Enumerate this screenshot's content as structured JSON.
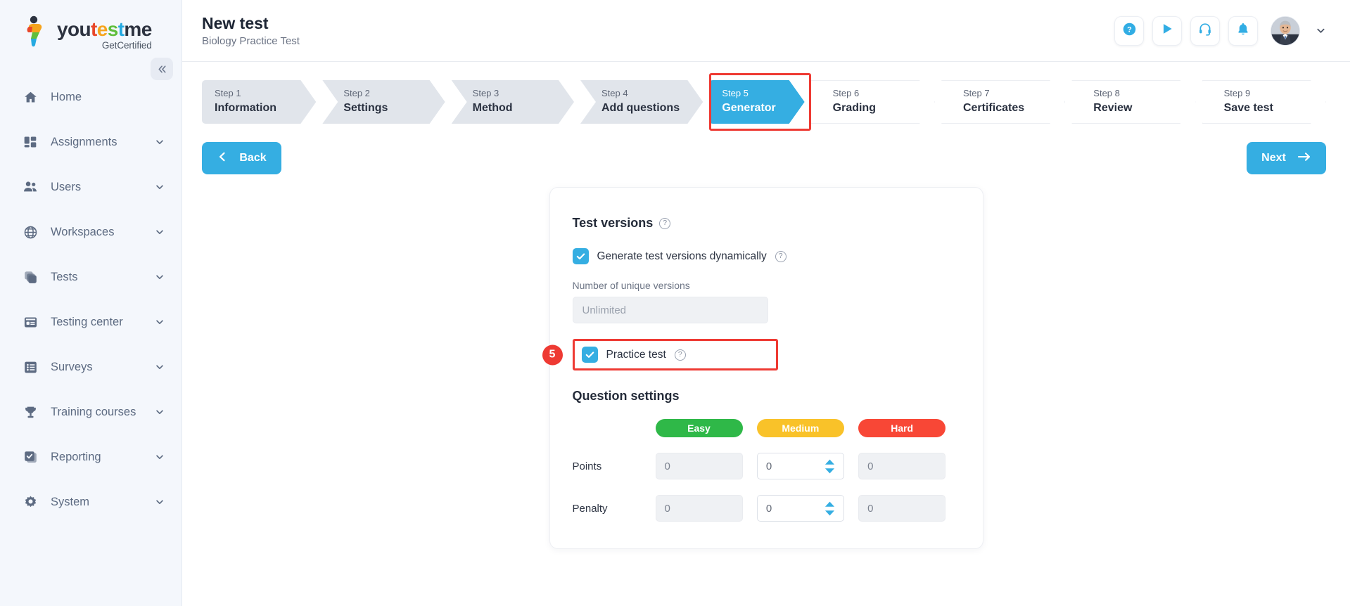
{
  "brand": {
    "name_parts": [
      {
        "text": "you",
        "color": "#2d3340"
      },
      {
        "text": "t",
        "color": "#e8472a"
      },
      {
        "text": "e",
        "color": "#f6a41c"
      },
      {
        "text": "s",
        "color": "#5fbe3b"
      },
      {
        "text": "t",
        "color": "#25aae1"
      },
      {
        "text": "me",
        "color": "#2d3340"
      }
    ],
    "tagline": "GetCertified",
    "collapse_icon": "double-chevron-left-icon"
  },
  "sidebar": {
    "items": [
      {
        "label": "Home",
        "icon": "home-icon",
        "caret": false
      },
      {
        "label": "Assignments",
        "icon": "assignments-icon",
        "caret": true
      },
      {
        "label": "Users",
        "icon": "users-icon",
        "caret": true
      },
      {
        "label": "Workspaces",
        "icon": "globe-icon",
        "caret": true
      },
      {
        "label": "Tests",
        "icon": "tests-stack-icon",
        "caret": true
      },
      {
        "label": "Testing center",
        "icon": "testing-center-icon",
        "caret": true
      },
      {
        "label": "Surveys",
        "icon": "surveys-list-icon",
        "caret": true
      },
      {
        "label": "Training courses",
        "icon": "trophy-icon",
        "caret": true
      },
      {
        "label": "Reporting",
        "icon": "reporting-icon",
        "caret": true
      },
      {
        "label": "System",
        "icon": "gear-icon",
        "caret": true
      }
    ]
  },
  "header": {
    "title": "New test",
    "subtitle": "Biology Practice Test",
    "actions": [
      {
        "name": "help-icon"
      },
      {
        "name": "play-icon"
      },
      {
        "name": "headset-support-icon"
      },
      {
        "name": "bell-notification-icon"
      }
    ],
    "avatar_caret": "chevron-down-icon"
  },
  "wizard": {
    "steps": [
      {
        "num": "Step 1",
        "name": "Information",
        "state": "done"
      },
      {
        "num": "Step 2",
        "name": "Settings",
        "state": "done"
      },
      {
        "num": "Step 3",
        "name": "Method",
        "state": "done"
      },
      {
        "num": "Step 4",
        "name": "Add questions",
        "state": "done"
      },
      {
        "num": "Step 5",
        "name": "Generator",
        "state": "active"
      },
      {
        "num": "Step 6",
        "name": "Grading",
        "state": "upcoming"
      },
      {
        "num": "Step 7",
        "name": "Certificates",
        "state": "upcoming"
      },
      {
        "num": "Step 8",
        "name": "Review",
        "state": "upcoming"
      },
      {
        "num": "Step 9",
        "name": "Save test",
        "state": "upcoming"
      }
    ],
    "active_highlight_color": "#ee3a33",
    "active_color": "#35aee2"
  },
  "nav_buttons": {
    "back_label": "Back",
    "next_label": "Next"
  },
  "card": {
    "test_versions_title": "Test versions",
    "generate_dynamically_label": "Generate test versions dynamically",
    "generate_dynamically_checked": true,
    "unique_versions_label": "Number of unique versions",
    "unique_versions_placeholder": "Unlimited",
    "unique_versions_value": "",
    "practice_test_label": "Practice test",
    "practice_test_checked": true,
    "practice_badge": "5",
    "question_settings_title": "Question settings",
    "difficulties": [
      {
        "label": "Easy",
        "color": "#2fb848"
      },
      {
        "label": "Medium",
        "color": "#f9c229"
      },
      {
        "label": "Hard",
        "color": "#f84736"
      }
    ],
    "rows": [
      {
        "label": "Points",
        "values": [
          "0",
          "0",
          "0"
        ],
        "enabled": [
          false,
          true,
          false
        ]
      },
      {
        "label": "Penalty",
        "values": [
          "0",
          "0",
          "0"
        ],
        "enabled": [
          false,
          true,
          false
        ]
      }
    ]
  }
}
